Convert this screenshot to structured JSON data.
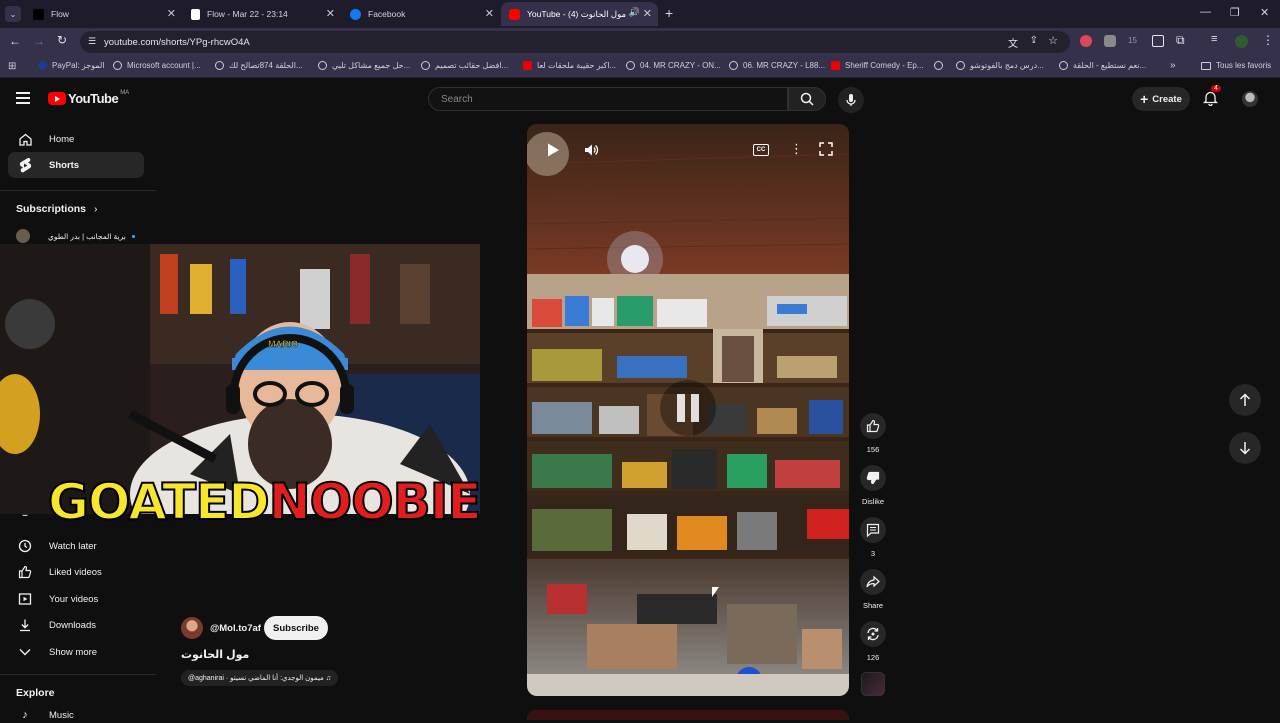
{
  "browser": {
    "tabs": [
      {
        "title": "Flow",
        "active": false
      },
      {
        "title": "Flow - Mar 22 - 23:14",
        "active": false
      },
      {
        "title": "Facebook",
        "active": false
      },
      {
        "title": "YouTube - مول الحانوت (4)",
        "active": true
      }
    ],
    "url": "youtube.com/shorts/YPg-rhcwO4A",
    "extension_count": "15",
    "bookmarks": [
      "PayPal: الموجز",
      "Microsoft account |...",
      "الحلقة 874تصالح لك...",
      "حل جميع مشاكل تليي...",
      "افضل حقائب تصميم...",
      "اكبر حقيبة ملحقات لعا...",
      "04. MR CRAZY - ON...",
      "06. MR CRAZY - L88...",
      "Sheriff Comedy - Ep...",
      "درس دمج بالفوتوشو...",
      "نعم نستطيع - الحلقة..."
    ],
    "all_bookmarks": "Tous les favoris"
  },
  "youtube": {
    "logo": "YouTube",
    "country": "MA",
    "search_placeholder": "Search",
    "create_label": "Create",
    "notifications_count": "4",
    "sidebar": {
      "home": "Home",
      "shorts": "Shorts",
      "subscriptions": "Subscriptions",
      "sub_channel": "برية المجانب | بدر الطوي",
      "watch_later": "Watch later",
      "liked": "Liked videos",
      "your_videos": "Your videos",
      "downloads": "Downloads",
      "show_more": "Show more",
      "explore": "Explore",
      "music": "Music"
    },
    "short": {
      "channel": "@Mol.to7af",
      "subscribe": "Subscribe",
      "title": "مول الحانوت",
      "music": "@aghanirai · ميمون الوجدي: أنا الماضي نسيتو ♫"
    },
    "actions": {
      "likes": "156",
      "dislike": "Dislike",
      "comments": "3",
      "share": "Share",
      "remix": "126"
    }
  },
  "overlay": {
    "brand_part1": "GOATED",
    "brand_part2": "NOOBIE",
    "cap_text": "MARIO"
  }
}
